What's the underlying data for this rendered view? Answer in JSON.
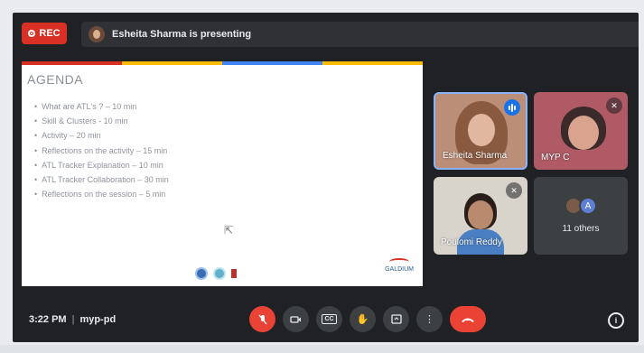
{
  "recording": {
    "label": "REC"
  },
  "presenter_banner": {
    "text": "Esheita Sharma is presenting"
  },
  "slide": {
    "title": "AGENDA",
    "items": [
      "What are ATL's ? – 10 min",
      "Skill & Clusters - 10 min",
      "Activity – 20 min",
      "Reflections on the activity – 15 min",
      "ATL Tracker Explanation – 10 min",
      "ATL Tracker Collaboration – 30 min",
      "Reflections on the session – 5 min"
    ],
    "logo_galdium": "GALDIUM",
    "stripe_colors": [
      "#d93025",
      "#fbbc04",
      "#4285f4",
      "#fbbc04"
    ]
  },
  "participants": [
    {
      "name": "Esheita Sharma",
      "status": "speaking"
    },
    {
      "name": "MYP C",
      "status": "muted"
    },
    {
      "name": "Poulomi Reddy",
      "status": "muted"
    }
  ],
  "others": {
    "avatar_letter": "A",
    "label": "11 others"
  },
  "bottom_bar": {
    "time": "3:22 PM",
    "separator": "|",
    "meeting_code": "myp-pd",
    "controls": [
      "mic-off",
      "camera",
      "captions",
      "raise-hand",
      "present",
      "more",
      "hang-up"
    ],
    "captions_label": "CC"
  },
  "colors": {
    "background": "#202124",
    "accent_red": "#ea4335",
    "speaking_blue": "#1a73e8"
  }
}
